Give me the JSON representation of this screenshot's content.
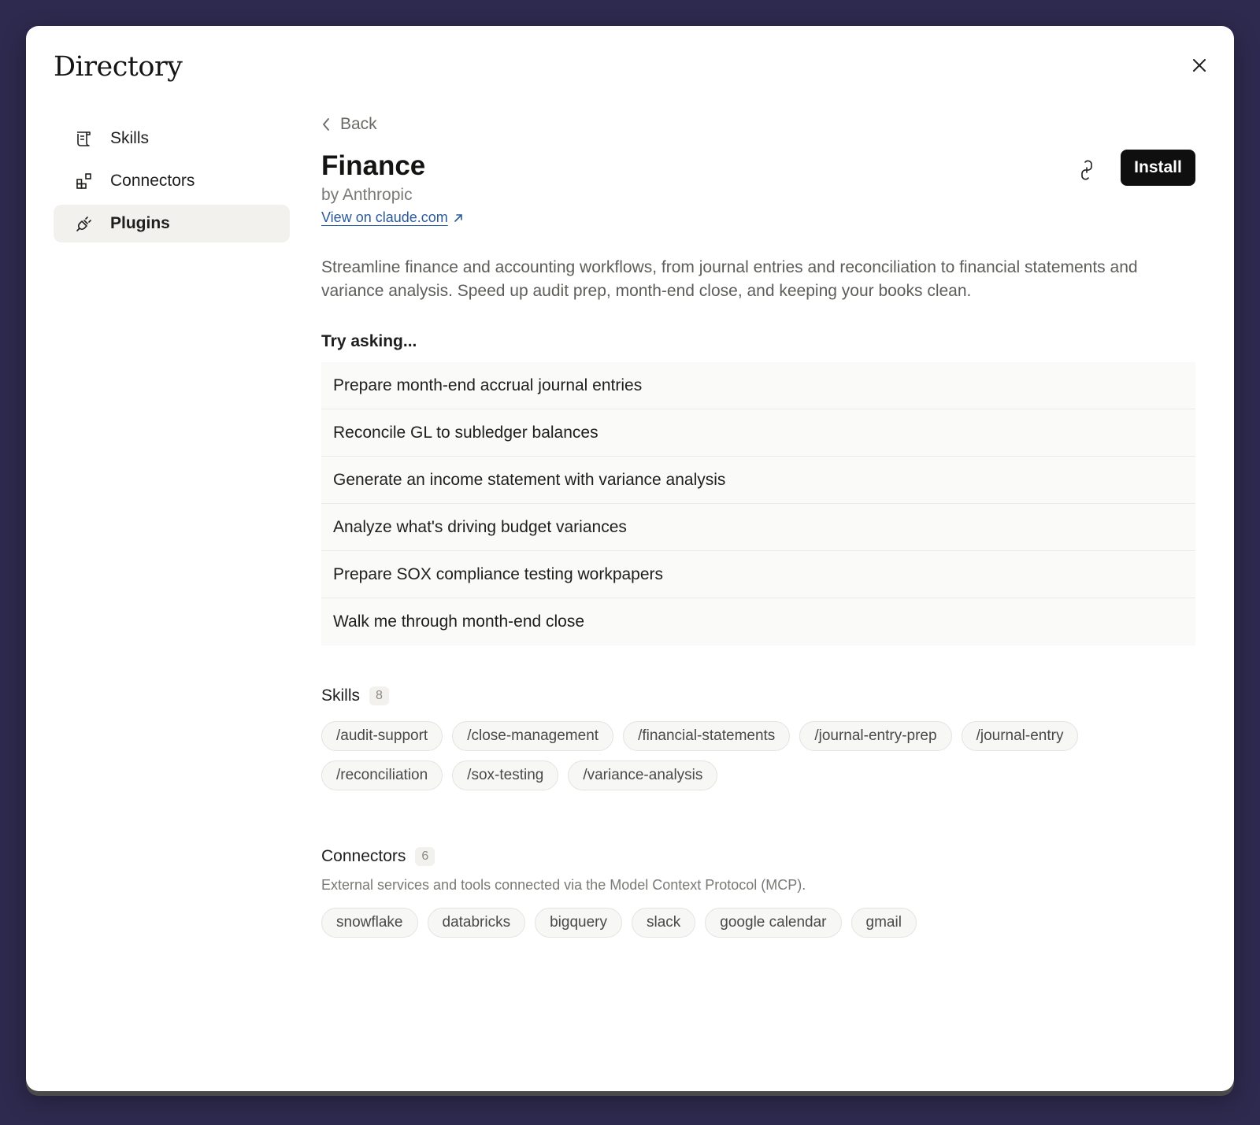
{
  "modal": {
    "title": "Directory"
  },
  "sidebar": {
    "items": [
      {
        "label": "Skills",
        "icon": "scroll-icon",
        "active": false
      },
      {
        "label": "Connectors",
        "icon": "blocks-icon",
        "active": false
      },
      {
        "label": "Plugins",
        "icon": "plug-icon",
        "active": true
      }
    ]
  },
  "detail": {
    "back_label": "Back",
    "title": "Finance",
    "author": "by Anthropic",
    "view_link": "View on claude.com",
    "install_label": "Install",
    "description": "Streamline finance and accounting workflows, from journal entries and reconciliation to financial statements and variance analysis. Speed up audit prep, month-end close, and keeping your books clean.",
    "try_heading": "Try asking...",
    "prompts": [
      "Prepare month-end accrual journal entries",
      "Reconcile GL to subledger balances",
      "Generate an income statement with variance analysis",
      "Analyze what's driving budget variances",
      "Prepare SOX compliance testing workpapers",
      "Walk me through month-end close"
    ],
    "skills": {
      "heading": "Skills",
      "count": "8",
      "items": [
        "/audit-support",
        "/close-management",
        "/financial-statements",
        "/journal-entry-prep",
        "/journal-entry",
        "/reconciliation",
        "/sox-testing",
        "/variance-analysis"
      ]
    },
    "connectors": {
      "heading": "Connectors",
      "count": "6",
      "description": "External services and tools connected via the Model Context Protocol (MCP).",
      "items": [
        "snowflake",
        "databricks",
        "bigquery",
        "slack",
        "google calendar",
        "gmail"
      ]
    }
  },
  "colors": {
    "backdrop": "#2e2a4f",
    "install_bg": "#0f0f0f",
    "link": "#2b5a9c"
  }
}
